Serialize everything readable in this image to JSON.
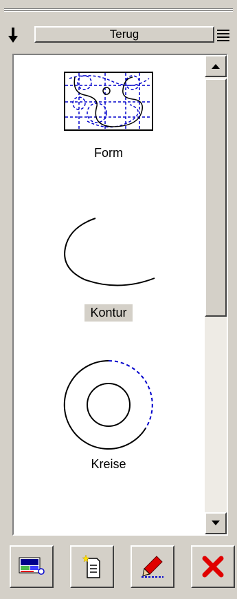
{
  "header": {
    "title_button": "Terug",
    "left_icon": "arrow-down-icon",
    "right_icon": "menu-list-icon"
  },
  "shapes": [
    {
      "label": "Form",
      "icon": "form-template-icon",
      "selected": false
    },
    {
      "label": "Kontur",
      "icon": "contour-arc-icon",
      "selected": true
    },
    {
      "label": "Kreise",
      "icon": "circles-icon",
      "selected": false
    }
  ],
  "scrollbar": {
    "up_icon": "scroll-up-arrow-icon",
    "down_icon": "scroll-down-arrow-icon"
  },
  "bottom_buttons": [
    {
      "name": "layout-view-button",
      "icon": "layout-view-icon"
    },
    {
      "name": "new-document-button",
      "icon": "new-document-icon"
    },
    {
      "name": "edit-pen-button",
      "icon": "pencil-icon"
    },
    {
      "name": "close-button",
      "icon": "red-x-icon"
    }
  ],
  "colors": {
    "background": "#d4d0c8",
    "dashed_blue": "#0000cc",
    "close_red": "#e00000"
  }
}
